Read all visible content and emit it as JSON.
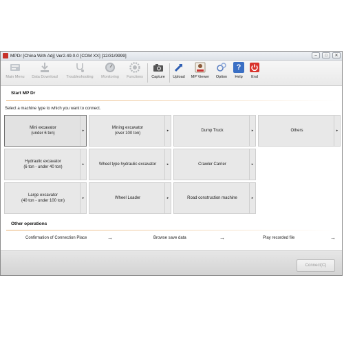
{
  "window": {
    "title": "MPDr [China With Adj] Ver2.49.0.0 [COM XX] [12/31/9999]",
    "controls": {
      "minimize": "–",
      "maximize": "□",
      "close": "✕"
    }
  },
  "toolbar": [
    {
      "label": "Main Menu",
      "icon": "main-menu-icon",
      "enabled": false
    },
    {
      "label": "Data Download",
      "icon": "download-icon",
      "enabled": false
    },
    {
      "label": "Troubleshooting",
      "icon": "stethoscope-icon",
      "enabled": false
    },
    {
      "label": "Monitoring",
      "icon": "gauge-icon",
      "enabled": false
    },
    {
      "label": "Functions",
      "icon": "gear-icon",
      "enabled": false
    },
    {
      "label": "Capture",
      "icon": "camera-icon",
      "enabled": true
    },
    {
      "label": "Upload",
      "icon": "upload-icon",
      "enabled": true
    },
    {
      "label": "MP Viewer",
      "icon": "viewer-icon",
      "enabled": true
    },
    {
      "label": "Option",
      "icon": "option-icon",
      "enabled": true
    },
    {
      "label": "Help",
      "icon": "help-icon",
      "glyph": "?",
      "enabled": true
    },
    {
      "label": "End",
      "icon": "power-icon",
      "enabled": true
    }
  ],
  "main": {
    "heading": "Start MP Dr",
    "prompt": "Select a machine type to which you want to connect.",
    "machines": [
      {
        "line1": "Mini excavator",
        "line2": "(under 6 ton)",
        "selected": true
      },
      {
        "line1": "Mining excavator",
        "line2": "(over 100 ton)"
      },
      {
        "line1": "Dump Truck",
        "line2": ""
      },
      {
        "line1": "Others",
        "line2": ""
      },
      {
        "line1": "Hydraulic excavator",
        "line2": "(6 ton - under 40 ton)"
      },
      {
        "line1": "Wheel type hydraulic excavator",
        "line2": ""
      },
      {
        "line1": "Crawler Carrier",
        "line2": ""
      },
      {
        "line1": "Large excavator",
        "line2": "(40 ton - under 100 ton)"
      },
      {
        "line1": "Wheel Loader",
        "line2": ""
      },
      {
        "line1": "Road construction machine",
        "line2": ""
      }
    ],
    "dropdown_glyph": "▸"
  },
  "other_operations": {
    "heading": "Other operations",
    "items": [
      {
        "label": "Confirmation of Connection Place"
      },
      {
        "label": "Browse save data"
      },
      {
        "label": "Play recorded file"
      }
    ],
    "arrow_glyph": "→"
  },
  "footer": {
    "connect_label": "Connect(C)"
  },
  "colors": {
    "accent_rule": "#e8b070",
    "end_red": "#d9332b",
    "help_blue": "#3a6fc4"
  }
}
